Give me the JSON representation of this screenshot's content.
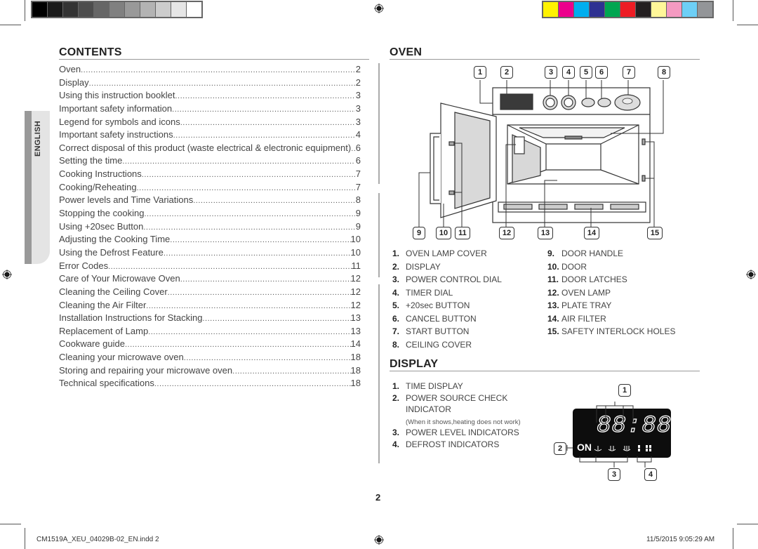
{
  "print_marks": {
    "grayscale_bar": [
      "#000000",
      "#1a1a1a",
      "#333333",
      "#4d4d4d",
      "#666666",
      "#808080",
      "#999999",
      "#b3b3b3",
      "#cccccc",
      "#e6e6e6",
      "#ffffff"
    ],
    "color_bar": [
      "#fff200",
      "#ec008c",
      "#00aeef",
      "#2e3192",
      "#00a651",
      "#ed1c24",
      "#231f20",
      "#fff799",
      "#f49ac1",
      "#6dcff6",
      "#939598"
    ]
  },
  "side_tab": {
    "label": "ENGLISH"
  },
  "contents": {
    "title": "CONTENTS",
    "items": [
      {
        "title": "Oven",
        "page": "2"
      },
      {
        "title": "Display",
        "page": "2"
      },
      {
        "title": "Using this instruction booklet",
        "page": "3"
      },
      {
        "title": "Important safety information ",
        "page": "3"
      },
      {
        "title": "Legend for symbols and icons",
        "page": "3"
      },
      {
        "title": "Important safety instructions",
        "page": "4"
      },
      {
        "title": "Correct disposal of this product (waste electrical & electronic equipment)",
        "page": "6"
      },
      {
        "title": "Setting the time",
        "page": "6"
      },
      {
        "title": "Cooking Instructions",
        "page": "7"
      },
      {
        "title": "Cooking/Reheating",
        "page": "7"
      },
      {
        "title": "Power levels and Time Variations",
        "page": "8"
      },
      {
        "title": "Stopping the cooking",
        "page": "9"
      },
      {
        "title": "Using +20sec Button",
        "page": "9"
      },
      {
        "title": "Adjusting the Cooking Time",
        "page": "10"
      },
      {
        "title": "Using the Defrost Feature",
        "page": "10"
      },
      {
        "title": "Error Codes",
        "page": "11"
      },
      {
        "title": "Care of Your Microwave Oven",
        "page": "12"
      },
      {
        "title": "Cleaning the Ceiling Cover",
        "page": "12"
      },
      {
        "title": "Cleaning the Air Filter",
        "page": "12"
      },
      {
        "title": "Installation Instructions for Stacking",
        "page": "13"
      },
      {
        "title": "Replacement of Lamp",
        "page": "13"
      },
      {
        "title": "Cookware guide",
        "page": "14"
      },
      {
        "title": "Cleaning your microwave oven",
        "page": "18"
      },
      {
        "title": "Storing and repairing your microwave oven",
        "page": "18"
      },
      {
        "title": "Technical specifications",
        "page": "18"
      }
    ]
  },
  "oven": {
    "title": "OVEN",
    "callouts_top": [
      "1",
      "2",
      "3",
      "4",
      "5",
      "6",
      "7",
      "8"
    ],
    "callouts_bottom": [
      "9",
      "10",
      "11",
      "12",
      "13",
      "14",
      "15"
    ],
    "parts_left": [
      {
        "num": "1.",
        "label": "OVEN LAMP COVER"
      },
      {
        "num": "2.",
        "label": "DISPLAY"
      },
      {
        "num": "3.",
        "label": "POWER CONTROL DIAL"
      },
      {
        "num": "4.",
        "label": "TIMER DIAL"
      },
      {
        "num": "5.",
        "label": "+20sec BUTTON"
      },
      {
        "num": "6.",
        "label": "CANCEL BUTTON"
      },
      {
        "num": "7.",
        "label": "START BUTTON"
      },
      {
        "num": "8.",
        "label": "CEILING COVER"
      }
    ],
    "parts_right": [
      {
        "num": "9.",
        "label": "DOOR HANDLE"
      },
      {
        "num": "10.",
        "label": "DOOR"
      },
      {
        "num": "11.",
        "label": "DOOR LATCHES"
      },
      {
        "num": "12.",
        "label": "OVEN LAMP"
      },
      {
        "num": "13.",
        "label": "PLATE TRAY"
      },
      {
        "num": "14.",
        "label": "AIR FILTER"
      },
      {
        "num": "15.",
        "label": "SAFETY INTERLOCK HOLES"
      }
    ]
  },
  "display": {
    "title": "DISPLAY",
    "items": [
      {
        "num": "1.",
        "label": "TIME DISPLAY"
      },
      {
        "num": "2.",
        "label": "POWER SOURCE CHECK"
      },
      {
        "num": "",
        "label": "INDICATOR"
      },
      {
        "num": "",
        "label": "(When it shows,heating does not work)"
      },
      {
        "num": "3.",
        "label": "POWER LEVEL INDICATORS"
      },
      {
        "num": "4.",
        "label": "DEFROST INDICATORS"
      }
    ],
    "panel": {
      "time": "88:88",
      "power_label": "ON"
    },
    "callouts": [
      "1",
      "2",
      "3",
      "4"
    ]
  },
  "page_number": "2",
  "footer": {
    "file": "CM1519A_XEU_04029B-02_EN.indd   2",
    "timestamp": "11/5/2015   9:05:29 AM"
  }
}
